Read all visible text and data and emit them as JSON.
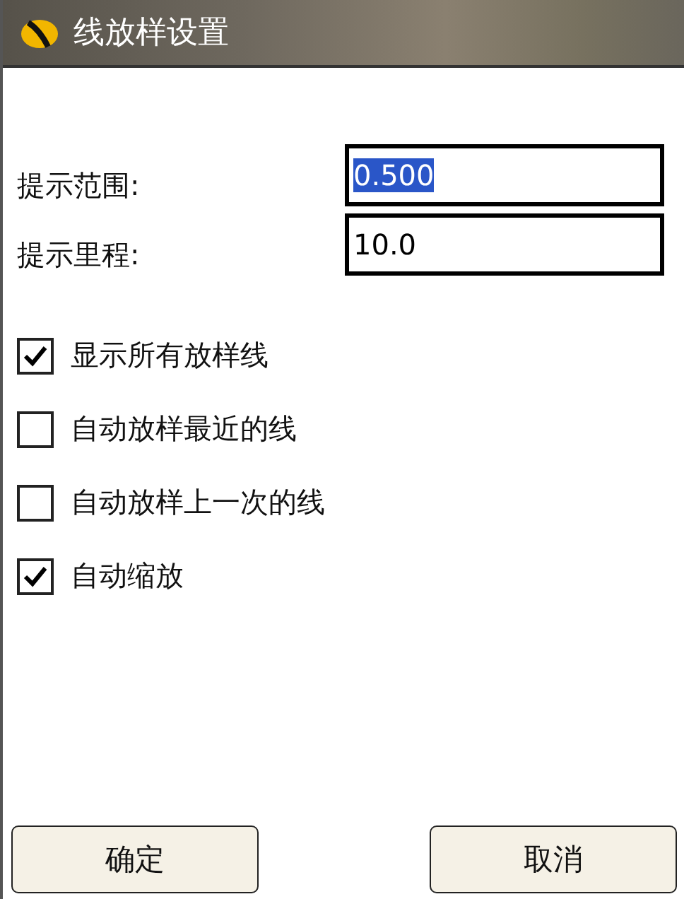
{
  "window": {
    "title": "线放样设置"
  },
  "fields": [
    {
      "label": "提示范围:",
      "value": "0.500",
      "text_selected": true
    },
    {
      "label": "提示里程:",
      "value": "10.0",
      "text_selected": false
    }
  ],
  "options": [
    {
      "label": "显示所有放样线",
      "checked": true
    },
    {
      "label": "自动放样最近的线",
      "checked": false
    },
    {
      "label": "自动放样上一次的线",
      "checked": false
    },
    {
      "label": "自动缩放",
      "checked": true
    }
  ],
  "buttons": [
    "确定",
    "取消"
  ]
}
